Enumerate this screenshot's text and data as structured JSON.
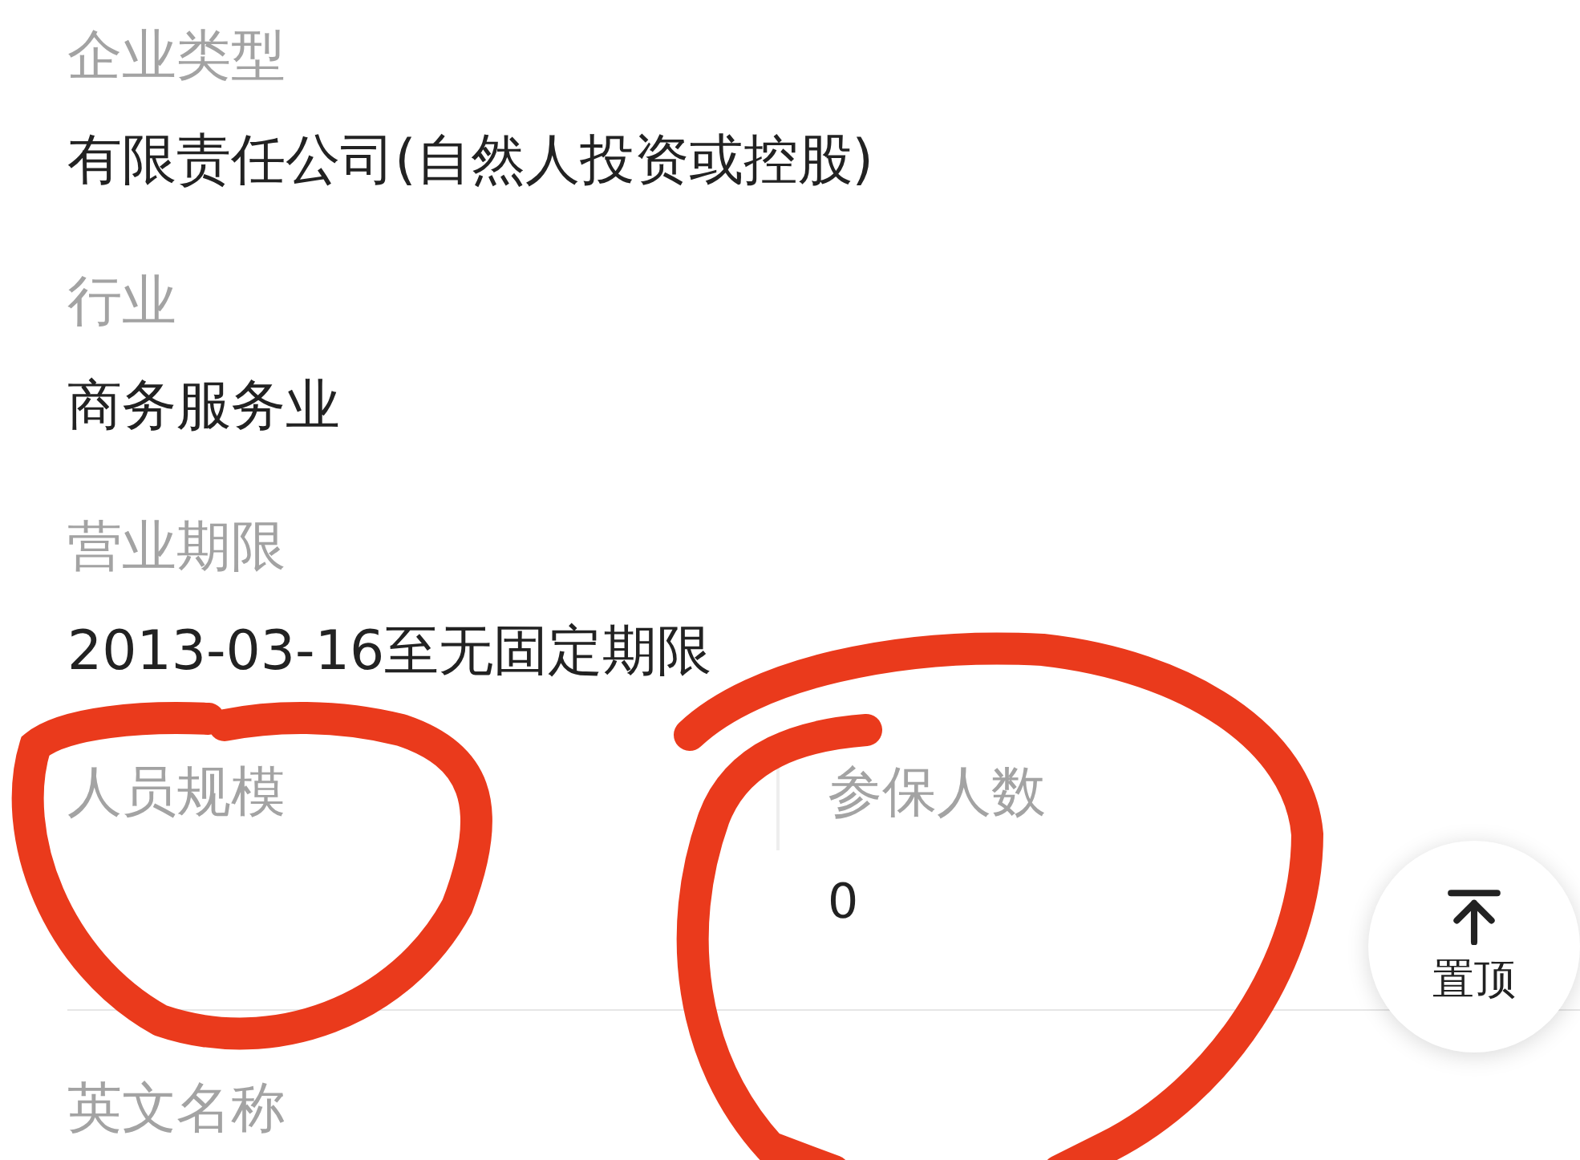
{
  "fields": [
    {
      "label": "企业类型",
      "value": "有限责任公司(自然人投资或控股)"
    },
    {
      "label": "行业",
      "value": "商务服务业"
    },
    {
      "label": "营业期限",
      "value": "2013-03-16至无固定期限"
    }
  ],
  "pair": [
    {
      "label": "人员规模"
    },
    {
      "label": "参保人数",
      "value": "0"
    }
  ],
  "next_field": {
    "label": "英文名称"
  },
  "top_button": {
    "label": "置顶"
  }
}
